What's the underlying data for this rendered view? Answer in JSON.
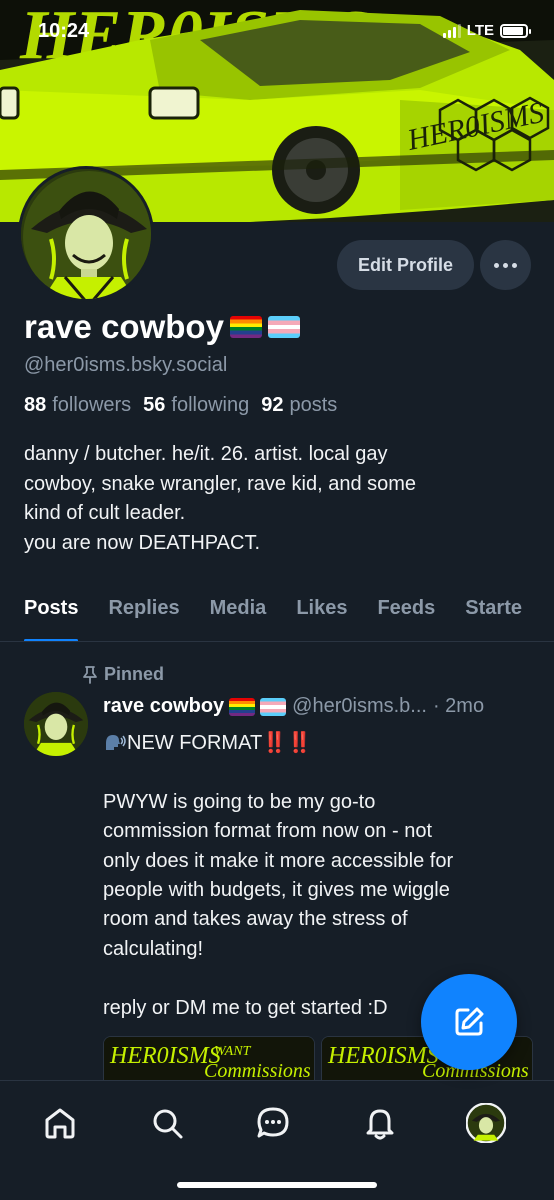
{
  "status_bar": {
    "time": "10:24",
    "network": "LTE",
    "battery_level": 0.9
  },
  "banner": {
    "graffiti_text": "HER0ISMS",
    "icon": "car-illustration"
  },
  "profile": {
    "display_name": "rave cowboy",
    "handle": "@her0isms.bsky.social",
    "edit_button_label": "Edit Profile",
    "more_icon": "ellipsis-icon",
    "stats": {
      "followers_count": "88",
      "followers_label": "followers",
      "following_count": "56",
      "following_label": "following",
      "posts_count": "92",
      "posts_label": "posts"
    },
    "bio_lines": [
      "danny / butcher. he/it. 26. artist. local gay",
      "cowboy, snake wrangler, rave kid, and some",
      "kind of cult leader.",
      "you are now DEATHPACT."
    ]
  },
  "tabs": [
    {
      "label": "Posts",
      "active": true
    },
    {
      "label": "Replies",
      "active": false
    },
    {
      "label": "Media",
      "active": false
    },
    {
      "label": "Likes",
      "active": false
    },
    {
      "label": "Feeds",
      "active": false
    },
    {
      "label": "Starte",
      "active": false
    }
  ],
  "post": {
    "pinned_label": "Pinned",
    "author": "rave cowboy",
    "handle": "@her0isms.b...",
    "time": "· 2mo",
    "headline": "NEW FORMAT",
    "headline_marks": "‼️‼️",
    "body_lines": [
      "",
      "PWYW is going to be my go-to",
      "commission format from now on - not",
      "only does it make it more accessible for",
      "people with budgets, it gives me wiggle",
      "room and takes away the stress of",
      "calculating!",
      "",
      "reply or DM me to get started :D"
    ],
    "image_text_1": "HER0ISMS",
    "image_text_2": "Commissions",
    "image_text_3": "WANT"
  },
  "bottom_nav": [
    {
      "icon": "home-icon"
    },
    {
      "icon": "search-icon"
    },
    {
      "icon": "chat-icon"
    },
    {
      "icon": "bell-icon"
    },
    {
      "icon": "avatar-icon"
    }
  ],
  "colors": {
    "background": "#161e27",
    "accent": "#1083fe",
    "muted": "#8c99a8",
    "lime": "#c5f000"
  }
}
